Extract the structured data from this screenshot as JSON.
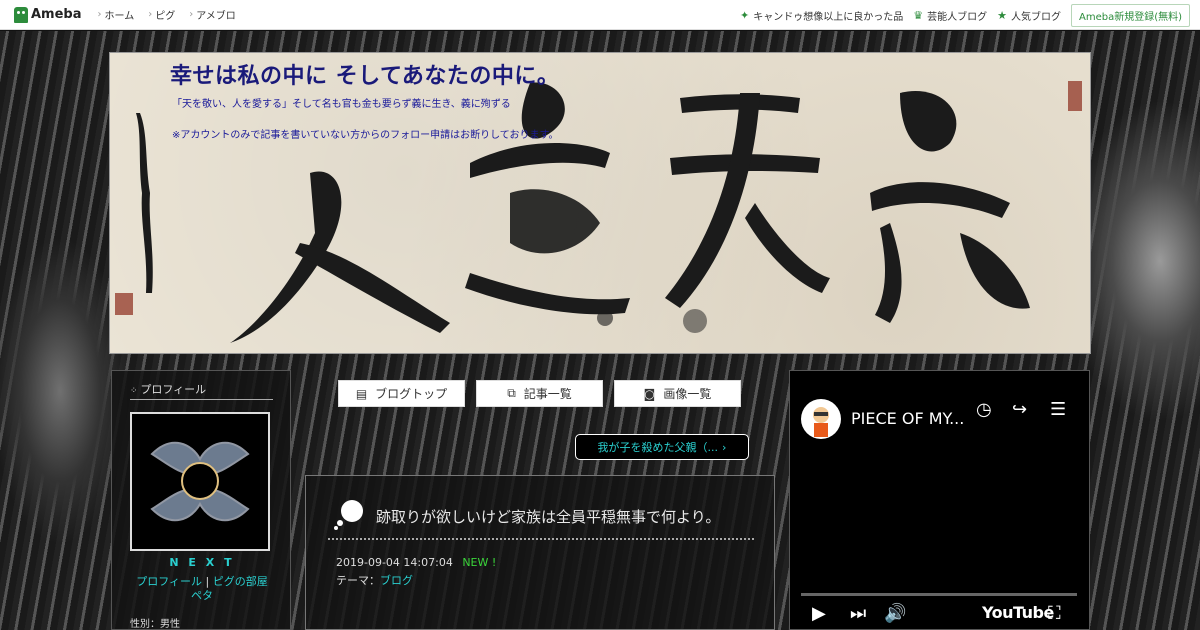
{
  "topbar": {
    "logo": "Ameba",
    "nav": [
      "ホーム",
      "ピグ",
      "アメブロ"
    ],
    "right_links": [
      {
        "icon": "sparkle-icon",
        "label": "キャンドゥ想像以上に良かった品"
      },
      {
        "icon": "crown-icon",
        "label": "芸能人ブログ"
      },
      {
        "icon": "star-icon",
        "label": "人気ブログ"
      }
    ],
    "signup": "Ameba新規登録(無料)"
  },
  "header": {
    "title": "幸せは私の中に そしてあなたの中に。",
    "description": "「天を敬い、人を愛する」そして名も官も金も要らず義に生き、義に殉ずる",
    "note": "※アカウントのみで記事を書いていない方からのフォロー申請はお断りしております。"
  },
  "profile": {
    "heading": "プロフィール",
    "nickname": "N E X T",
    "link_profile": "プロフィール",
    "separator": "|",
    "link_room": "ピグの部屋",
    "link_peta": "ペタ",
    "gender": "性別：男性"
  },
  "nav": {
    "blog_top": "ブログトップ",
    "articles": "記事一覧",
    "images": "画像一覧"
  },
  "prev_entry": "我が子を殺めた父親（...",
  "entry": {
    "title": "跡取りが欲しいけど家族は全員平穏無事で何より。",
    "datetime": "2019-09-04 14:07:04",
    "new_label": "NEW !",
    "theme_label": "テーマ：",
    "theme": "ブログ"
  },
  "youtube": {
    "title": "PIECE OF MY...",
    "logo": "YouTube"
  },
  "colors": {
    "accent_link": "#2ad0d0",
    "title_blue": "#1a1a7a",
    "ameba_green": "#2d8c3c",
    "new_green": "#3bd63b"
  }
}
